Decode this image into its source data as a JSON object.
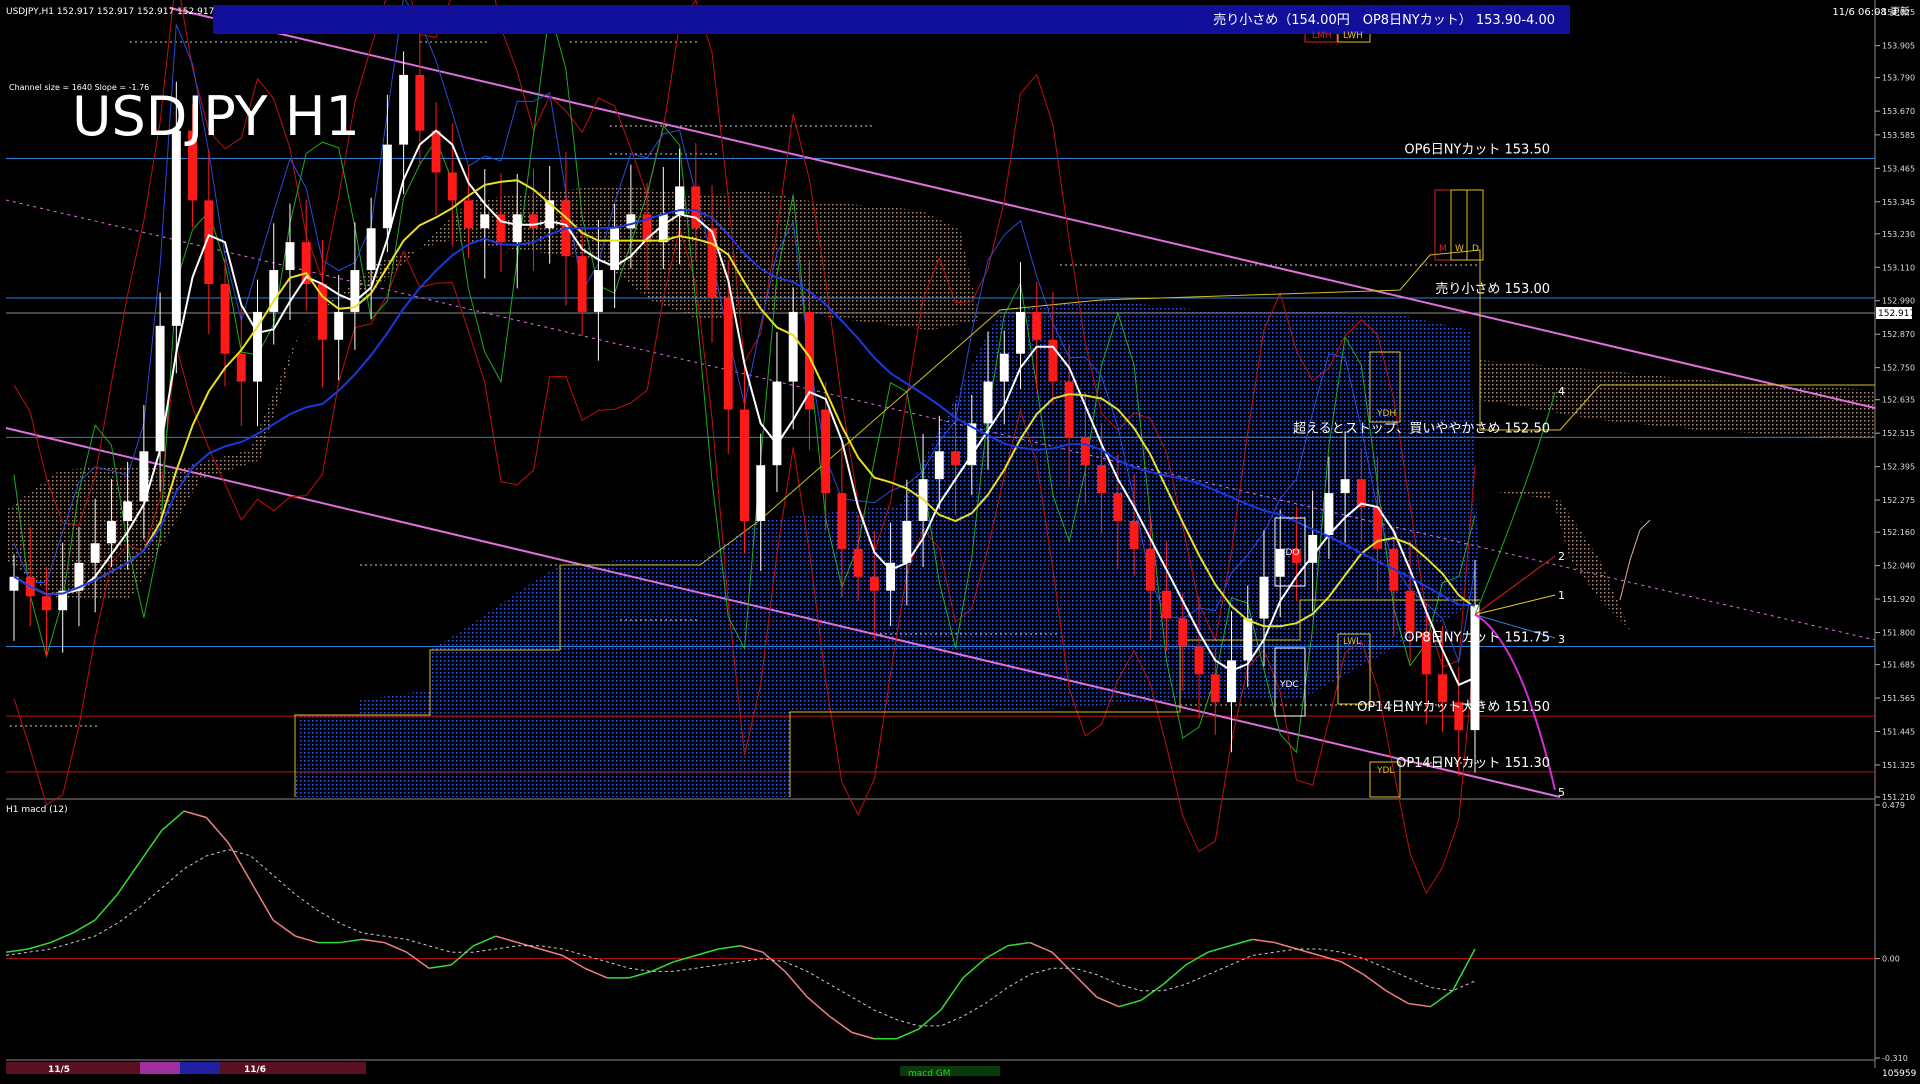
{
  "header": {
    "symbol_info": "USDJPY,H1  152.917 152.917 152.917 152.917",
    "big_title": "USDJPY H1",
    "channel_info": "Channel size = 1640 Slope = -1.76",
    "datetime": "11/6 06:08 更新"
  },
  "banner": {
    "text": "売り小さめ（154.00円　OP8日NYカット） 153.90-4.00",
    "bg_color": "#10109a"
  },
  "box_labels": {
    "lmh": "LMH",
    "lwh": "LWH",
    "ydh": "YDH",
    "ydo": "YDO",
    "ydc": "YDC",
    "lwl": "LWL",
    "ydl": "YDL",
    "m": "M",
    "w": "W",
    "d": "D"
  },
  "levels": [
    {
      "price": 153.5,
      "label": "OP6日NYカット 153.50",
      "color": "#2a7fd0"
    },
    {
      "price": 153.0,
      "label": "売り小さめ 153.00",
      "color": "#2a7fd0"
    },
    {
      "price": 152.5,
      "label": "超えるとストップ、買いややかさめ 152.50",
      "color": "#2a7fd0"
    },
    {
      "price": 151.75,
      "label": "OP8日NYカット 151.75",
      "color": "#2a7fd0"
    },
    {
      "price": 151.5,
      "label": "OP14日NYカット大きめ 151.50",
      "color": "#c01010"
    },
    {
      "price": 151.3,
      "label": "OP14日NYカット 151.30",
      "color": "#c01010"
    }
  ],
  "projection_labels": [
    "1",
    "2",
    "3",
    "4",
    "5"
  ],
  "current_price": "152.917",
  "chart_data": [
    {
      "type": "candlestick",
      "ylim": [
        151.21,
        154.04
      ],
      "y_ticks": [
        154.025,
        153.905,
        153.79,
        153.67,
        153.585,
        153.465,
        153.345,
        153.23,
        153.11,
        152.99,
        152.87,
        152.75,
        152.635,
        152.515,
        152.395,
        152.275,
        152.16,
        152.04,
        151.92,
        151.8,
        151.685,
        151.565,
        151.445,
        151.325,
        151.21
      ],
      "x_ticks": [
        "11/5",
        "11/6"
      ],
      "closes": [
        152.0,
        151.93,
        151.88,
        151.95,
        152.05,
        152.12,
        152.2,
        152.27,
        152.45,
        152.9,
        153.6,
        153.35,
        153.05,
        152.8,
        152.7,
        152.95,
        153.1,
        153.2,
        153.05,
        152.85,
        152.95,
        153.1,
        153.25,
        153.55,
        153.8,
        153.6,
        153.45,
        153.35,
        153.25,
        153.3,
        153.2,
        153.3,
        153.25,
        153.35,
        153.15,
        152.95,
        153.1,
        153.25,
        153.3,
        153.2,
        153.3,
        153.4,
        153.25,
        153.0,
        152.6,
        152.2,
        152.4,
        152.7,
        152.95,
        152.6,
        152.3,
        152.1,
        152.0,
        151.95,
        152.05,
        152.2,
        152.35,
        152.45,
        152.4,
        152.55,
        152.7,
        152.8,
        152.95,
        152.85,
        152.7,
        152.5,
        152.4,
        152.3,
        152.2,
        152.1,
        151.95,
        151.85,
        151.75,
        151.65,
        151.55,
        151.7,
        151.85,
        152.0,
        152.1,
        152.05,
        152.15,
        152.3,
        152.35,
        152.25,
        152.1,
        151.95,
        151.8,
        151.65,
        151.55,
        151.45,
        151.9
      ],
      "color_up": "#ffffff",
      "color_down": "#ff1a1a",
      "overlays": [
        "moving averages",
        "bollinger bands",
        "ichimoku cloud",
        "linear regression channel"
      ]
    },
    {
      "type": "line",
      "indicator_label": "H1  macd (12)",
      "ylim": [
        -0.31,
        0.479
      ],
      "y_ticks": [
        0.479,
        0.0,
        -0.31
      ],
      "signal_label": "macd GM",
      "volume_label": "105959",
      "series": [
        {
          "values": [
            0.02,
            0.03,
            0.05,
            0.08,
            0.12,
            0.2,
            0.3,
            0.4,
            0.46,
            0.44,
            0.36,
            0.24,
            0.12,
            0.07,
            0.05,
            0.05,
            0.06,
            0.05,
            0.02,
            -0.03,
            -0.02,
            0.04,
            0.07,
            0.05,
            0.03,
            0.01,
            -0.03,
            -0.06,
            -0.06,
            -0.04,
            -0.01,
            0.01,
            0.03,
            0.04,
            0.02,
            -0.04,
            -0.12,
            -0.18,
            -0.23,
            -0.25,
            -0.25,
            -0.22,
            -0.16,
            -0.06,
            0.0,
            0.04,
            0.05,
            0.02,
            -0.05,
            -0.12,
            -0.15,
            -0.13,
            -0.08,
            -0.02,
            0.02,
            0.04,
            0.06,
            0.05,
            0.03,
            0.01,
            -0.01,
            -0.05,
            -0.1,
            -0.14,
            -0.15,
            -0.1,
            0.03
          ]
        },
        {
          "values": [
            0.01,
            0.02,
            0.03,
            0.05,
            0.07,
            0.11,
            0.16,
            0.22,
            0.28,
            0.32,
            0.34,
            0.32,
            0.26,
            0.2,
            0.15,
            0.11,
            0.08,
            0.07,
            0.06,
            0.04,
            0.02,
            0.02,
            0.03,
            0.04,
            0.04,
            0.03,
            0.01,
            -0.01,
            -0.03,
            -0.04,
            -0.04,
            -0.03,
            -0.02,
            -0.01,
            0.0,
            -0.01,
            -0.04,
            -0.08,
            -0.12,
            -0.16,
            -0.19,
            -0.21,
            -0.21,
            -0.18,
            -0.14,
            -0.09,
            -0.05,
            -0.03,
            -0.03,
            -0.05,
            -0.08,
            -0.1,
            -0.1,
            -0.08,
            -0.05,
            -0.02,
            0.01,
            0.02,
            0.03,
            0.03,
            0.02,
            0.0,
            -0.03,
            -0.06,
            -0.09,
            -0.1,
            -0.07
          ]
        }
      ]
    }
  ]
}
